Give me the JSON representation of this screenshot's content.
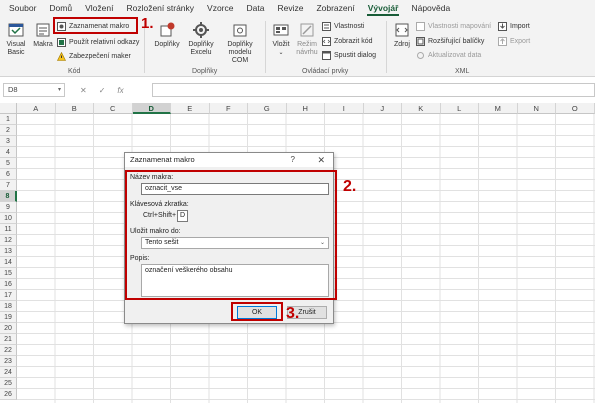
{
  "menu": {
    "tabs": [
      "Soubor",
      "Domů",
      "Vložení",
      "Rozložení stránky",
      "Vzorce",
      "Data",
      "Revize",
      "Zobrazení",
      "Vývojář",
      "Nápověda"
    ],
    "active_tab": "Vývojář"
  },
  "ribbon": {
    "kod": {
      "visual_basic": "Visual Basic",
      "makra": "Makra",
      "zaznamenat": "Zaznamenat makro",
      "relativni": "Použít relativní odkazy",
      "zabezpeceni": "Zabezpečení maker",
      "group_label": "Kód"
    },
    "doplnky": {
      "doplnky": "Doplňky",
      "doplnky_excelu_1": "Doplňky",
      "doplnky_excelu_2": "Excelu",
      "com_1": "Doplňky",
      "com_2": "modelu COM",
      "group_label": "Doplňky"
    },
    "ovladaci": {
      "vlozit": "Vložit",
      "rezim_1": "Režim",
      "rezim_2": "návrhu",
      "vlastnosti": "Vlastnosti",
      "zobrazit_kod": "Zobrazit kód",
      "spustit_dialog": "Spustit dialog",
      "group_label": "Ovládací prvky"
    },
    "xml": {
      "zdroj": "Zdroj",
      "vlastnosti_mapovani": "Vlastnosti mapování",
      "rozsirujici_balicky": "Rozšiřující balíčky",
      "aktualizovat": "Aktualizovat data",
      "import": "Import",
      "export": "Export",
      "group_label": "XML"
    }
  },
  "formula_bar": {
    "name_box": "D8",
    "cancel": "✕",
    "enter": "✓",
    "fx": "fx",
    "value": ""
  },
  "grid": {
    "columns": [
      "A",
      "B",
      "C",
      "D",
      "E",
      "F",
      "G",
      "H",
      "I",
      "J",
      "K",
      "L",
      "M",
      "N",
      "O"
    ],
    "rows": [
      "1",
      "2",
      "3",
      "4",
      "5",
      "6",
      "7",
      "8",
      "9",
      "10",
      "11",
      "12",
      "13",
      "14",
      "15",
      "16",
      "17",
      "18",
      "19",
      "20",
      "21",
      "22",
      "23",
      "24",
      "25",
      "26"
    ],
    "active_cell": "D8"
  },
  "dialog": {
    "title": "Zaznamenat makro",
    "help": "?",
    "close": "✕",
    "name_label": "Název makra:",
    "name_value": "oznacit_vse",
    "shortcut_label": "Klávesová zkratka:",
    "shortcut_prefix": "Ctrl+Shift+",
    "shortcut_value": "D",
    "store_label": "Uložit makro do:",
    "store_value": "Tento sešit",
    "desc_label": "Popis:",
    "desc_value": "označení veškerého obsahu",
    "ok": "OK",
    "cancel": "Zrušit"
  },
  "annotations": {
    "step1": "1.",
    "step2": "2.",
    "step3": "3."
  },
  "colors": {
    "accent": "#217346",
    "highlight": "#c00000"
  }
}
